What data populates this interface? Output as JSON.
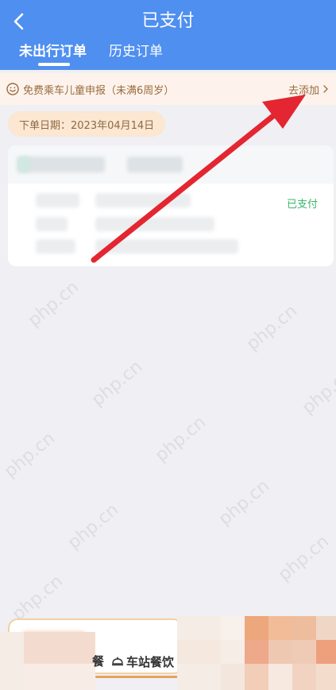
{
  "header": {
    "title": "已支付",
    "tabs": [
      {
        "label": "未出行订单",
        "active": true
      },
      {
        "label": "历史订单",
        "active": false
      }
    ]
  },
  "notice": {
    "text": "免费乘车儿童申报（未满6周岁）",
    "action_label": "去添加"
  },
  "order_group": {
    "date_label": "下单日期：2023年04月14日"
  },
  "order_card": {
    "status": "已支付"
  },
  "bottom": {
    "partial_label": "餐",
    "food_label": "车站餐饮"
  },
  "colors": {
    "header_bg": "#4f8ff0",
    "page_bg": "#efeff4",
    "notice_bg": "#fdf3ec",
    "chip_bg": "#fbe7d2",
    "status_green": "#3bb46a"
  },
  "watermark": "php.cn"
}
